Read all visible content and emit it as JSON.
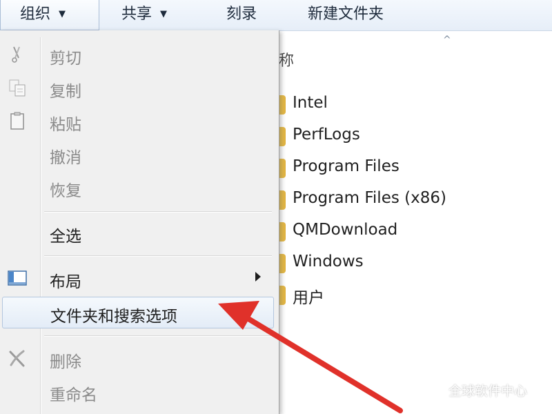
{
  "toolbar": {
    "organize": "组织",
    "share": "共享",
    "burn": "刻录",
    "new_folder": "新建文件夹"
  },
  "file_list": {
    "column_name": "称",
    "items": [
      "Intel",
      "PerfLogs",
      "Program Files",
      "Program Files (x86)",
      "QMDownload",
      "Windows",
      "用户"
    ]
  },
  "menu": {
    "cut": "剪切",
    "copy": "复制",
    "paste": "粘贴",
    "undo": "撤消",
    "redo": "恢复",
    "select_all": "全选",
    "layout": "布局",
    "folder_options": "文件夹和搜索选项",
    "delete": "删除",
    "rename": "重命名"
  },
  "watermark": {
    "text": "全球软件中心"
  },
  "icons": {
    "cut": "scissors-icon",
    "copy": "copy-icon",
    "paste": "clipboard-icon",
    "layout": "layout-icon",
    "delete": "delete-x-icon",
    "folder": "folder-icon",
    "sort": "sort-ascending-icon"
  },
  "colors": {
    "annotation_arrow": "#e0312a",
    "menu_background": "#f0f0f0",
    "highlight_border": "#b3c6de",
    "disabled_text": "#8a8a8a"
  }
}
